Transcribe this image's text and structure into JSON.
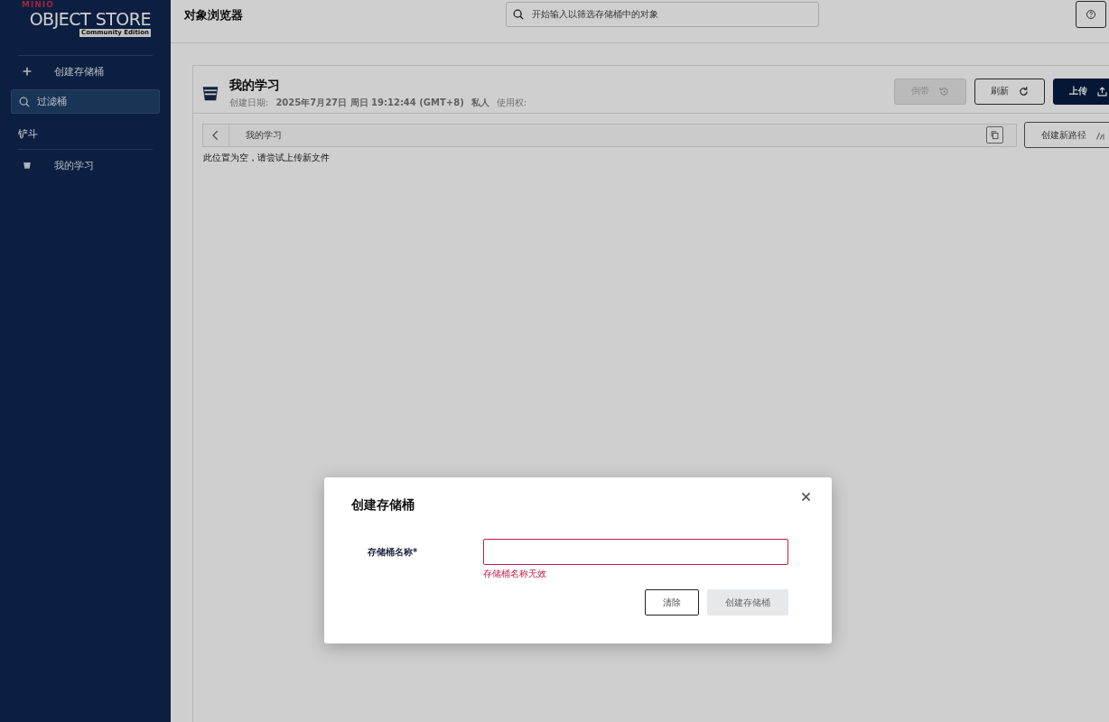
{
  "sidebar": {
    "logo": {
      "brand": "MINIO",
      "product": "OBJECT STORE",
      "edition": "Community Edition"
    },
    "create_bucket": "创建存储桶",
    "filter": {
      "placeholder": "过滤桶"
    },
    "section": "铲斗",
    "buckets": [
      {
        "name": "我的学习"
      }
    ]
  },
  "header": {
    "title": "对象浏览器",
    "search": {
      "placeholder": "开始输入以筛选存储桶中的对象"
    }
  },
  "bucket": {
    "name": "我的学习",
    "created_label": "创建日期:",
    "created_value": "2025年7月27日 周日 19:12:44 (GMT+8)",
    "access": "私人",
    "usage_label": "使用权:",
    "actions": [
      {
        "label": "倒带",
        "kind": "rewind",
        "disabled": true
      },
      {
        "label": "刷新",
        "kind": "refresh",
        "disabled": false
      },
      {
        "label": "上传",
        "kind": "upload",
        "disabled": false
      }
    ],
    "breadcrumb": "我的学习",
    "new_path": "创建新路径",
    "empty_message": "此位置为空，请尝试上传新文件"
  },
  "dialog": {
    "title": "创建存储桶",
    "field": {
      "label": "存储桶名称*",
      "invalid": true,
      "error": "存储桶名称无效"
    },
    "buttons": [
      {
        "label": "清除",
        "kind": "clear",
        "disabled": false
      },
      {
        "label": "创建存储桶",
        "kind": "create",
        "disabled": true
      }
    ]
  }
}
